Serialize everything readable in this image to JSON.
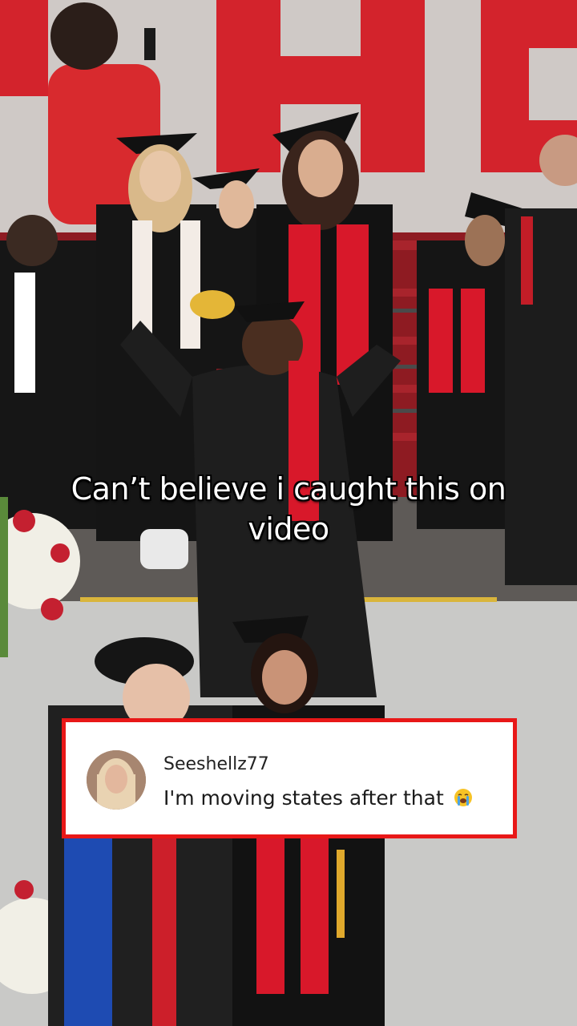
{
  "caption": {
    "line1": "Can’t believe i caught this on",
    "line2": "video"
  },
  "comment": {
    "username": "Seeshellz77",
    "text": "I'm moving states after that",
    "emoji": "loudly-crying-face-icon"
  },
  "colors": {
    "comment_border": "#e81818",
    "caption_text": "#ffffff",
    "stole_red": "#d8182a"
  }
}
